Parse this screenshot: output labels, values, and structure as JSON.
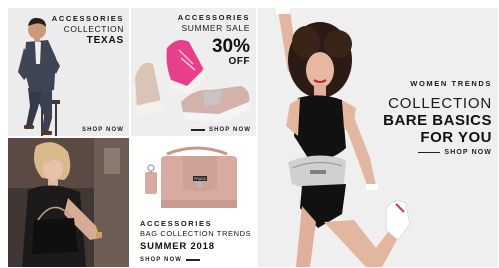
{
  "tiles": {
    "texas": {
      "eyebrow": "ACCESSORIES",
      "line2": "COLLECTION",
      "headline": "TEXAS",
      "cta": "SHOP NOW"
    },
    "shoes": {
      "eyebrow": "ACCESSORIES",
      "line2": "SUMMER SALE",
      "discount": "30%",
      "discount_suffix": "OFF",
      "cta": "SHOP NOW"
    },
    "bag": {
      "eyebrow": "ACCESSORIES",
      "line2": "BAG COLLECTION TRENDS",
      "headline": "SUMMER 2018",
      "cta": "SHOP NOW",
      "tag_text": "PRADA"
    },
    "hero": {
      "eyebrow": "WOMEN TRENDS",
      "title": "COLLECTION",
      "subtitle_line1": "BARE BASICS",
      "subtitle_line2": "FOR YOU",
      "cta": "SHOP NOW"
    }
  },
  "colors": {
    "tile_bg": "#ececec",
    "text_dark": "#1a1a1a",
    "bag_pink": "#d8aaa0",
    "sneaker_pink": "#e83f8a",
    "hero_bg": "#efefef"
  }
}
